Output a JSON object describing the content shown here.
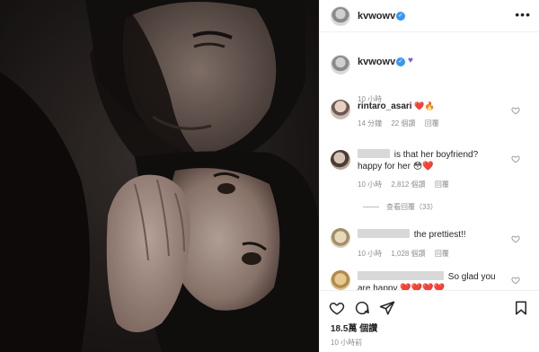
{
  "post": {
    "username": "kvwowv",
    "more_label": "•••"
  },
  "caption": {
    "username": "kvwowv",
    "time": "10 小時"
  },
  "comments": [
    {
      "username": "rintaro_asari",
      "text": "",
      "emojis": "❤️🔥",
      "time": "14 分鐘",
      "likes": "22 個讚",
      "reply": "回覆"
    },
    {
      "username": "",
      "text": "is that her boyfriend?",
      "text2": "happy for her 😳❤️",
      "time": "10 小時",
      "likes": "2,812 個讚",
      "reply": "回覆",
      "view_replies": "查看回覆（33）"
    },
    {
      "username": "",
      "text": "the prettiest!!",
      "time": "10 小時",
      "likes": "1,028 個讚",
      "reply": "回覆"
    },
    {
      "username": "",
      "text": "So glad you",
      "text2": "are happy ❤️❤️❤️❤️"
    }
  ],
  "actions": {
    "likes": "18.5萬 個讚",
    "time": "10 小時前"
  },
  "colors": {
    "verified": "#3897f0",
    "heart_emoji": "#ed4956",
    "secondary_text": "#8e8e8e"
  },
  "icons": [
    "more-icon",
    "verified-icon",
    "heart-icon",
    "comment-icon",
    "share-icon",
    "bookmark-icon"
  ]
}
